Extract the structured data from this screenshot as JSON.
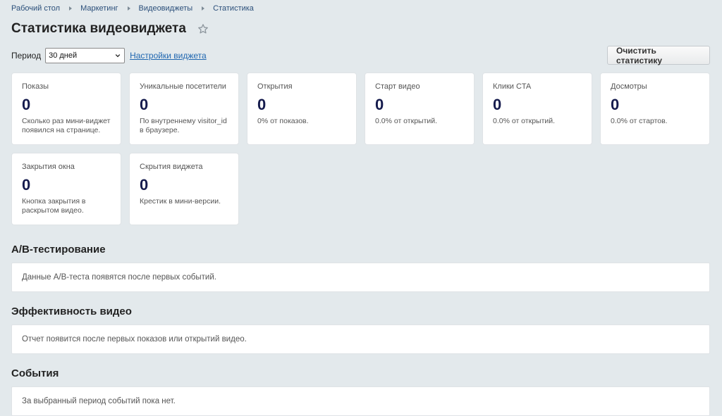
{
  "breadcrumb": [
    "Рабочий стол",
    "Маркетинг",
    "Видеовиджеты",
    "Статистика"
  ],
  "page_title": "Статистика видеовиджета",
  "toolbar": {
    "period_label": "Период",
    "period_value": "30 дней",
    "settings_link": "Настройки виджета",
    "clear_button": "Очистить статистику"
  },
  "stats": [
    {
      "label": "Показы",
      "value": "0",
      "desc": "Сколько раз мини-виджет появился на странице."
    },
    {
      "label": "Уникальные посетители",
      "value": "0",
      "desc": "По внутреннему visitor_id в браузере."
    },
    {
      "label": "Открытия",
      "value": "0",
      "desc": "0% от показов."
    },
    {
      "label": "Старт видео",
      "value": "0",
      "desc": "0.0% от открытий."
    },
    {
      "label": "Клики CTA",
      "value": "0",
      "desc": "0.0% от открытий."
    },
    {
      "label": "Досмотры",
      "value": "0",
      "desc": "0.0% от стартов."
    },
    {
      "label": "Закрытия окна",
      "value": "0",
      "desc": "Кнопка закрытия в раскрытом видео."
    },
    {
      "label": "Скрытия виджета",
      "value": "0",
      "desc": "Крестик в мини-версии."
    }
  ],
  "sections": [
    {
      "title": "A/B-тестирование",
      "text": "Данные A/B-теста появятся после первых событий."
    },
    {
      "title": "Эффективность видео",
      "text": "Отчет появится после первых показов или открытий видео."
    },
    {
      "title": "События",
      "text": "За выбранный период событий пока нет."
    }
  ],
  "colors": {
    "background": "#e3e9ec",
    "value": "#151b4d",
    "link": "#2067b0"
  },
  "icons": {
    "star": "star-icon",
    "breadcrumb_separator": "chevron-right-icon",
    "select": "chevron-down-icon"
  }
}
